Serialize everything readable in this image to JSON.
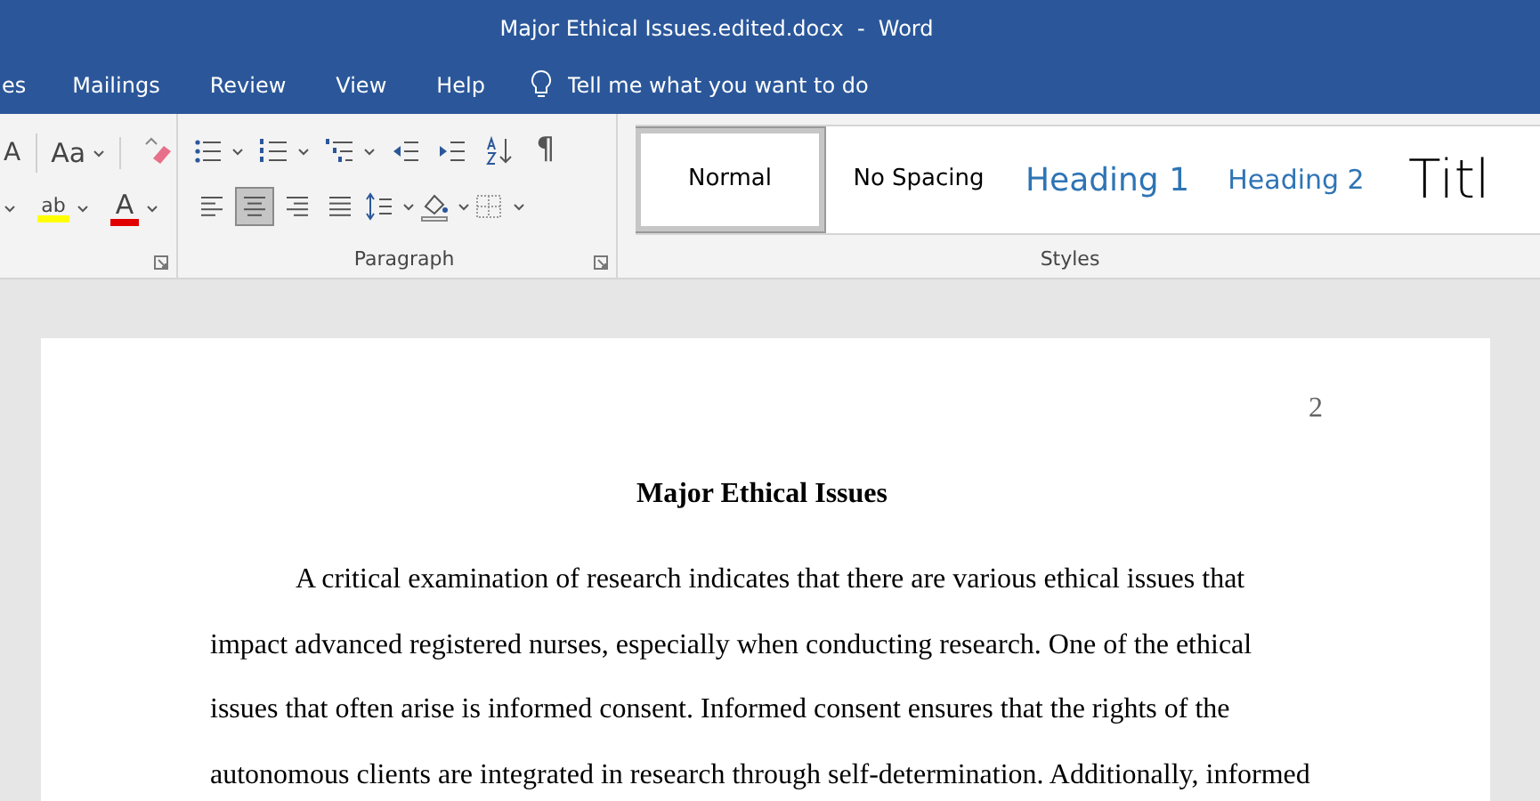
{
  "window": {
    "title": "Major Ethical Issues.edited.docx  -  Word"
  },
  "tabs": [
    {
      "label": "es",
      "selected": false
    },
    {
      "label": "Mailings",
      "selected": false
    },
    {
      "label": "Review",
      "selected": false
    },
    {
      "label": "View",
      "selected": false
    },
    {
      "label": "Help",
      "selected": false
    }
  ],
  "tell_me": {
    "placeholder": "Tell me what you want to do"
  },
  "font_group": {
    "row1": [
      {
        "kind": "shrink",
        "label": "A"
      },
      {
        "kind": "case",
        "label": "Aa"
      },
      {
        "kind": "clear"
      }
    ],
    "row2": [
      {
        "kind": "highlight",
        "label": "ab"
      },
      {
        "kind": "color",
        "label": "A"
      }
    ]
  },
  "paragraph_group": {
    "label": "Paragraph",
    "row1": [
      {
        "kind": "bullets"
      },
      {
        "kind": "numbering"
      },
      {
        "kind": "multilevel"
      },
      {
        "kind": "outdent"
      },
      {
        "kind": "indent"
      },
      {
        "kind": "sort"
      },
      {
        "kind": "pilcrow",
        "label": "¶"
      }
    ],
    "row2": [
      {
        "kind": "align-left",
        "selected": false
      },
      {
        "kind": "align-center",
        "selected": true
      },
      {
        "kind": "align-right",
        "selected": false
      },
      {
        "kind": "justify",
        "selected": false
      },
      {
        "kind": "line-spacing"
      },
      {
        "kind": "shading"
      },
      {
        "kind": "borders"
      }
    ]
  },
  "styles_group": {
    "label": "Styles",
    "styles": [
      {
        "label": "Normal",
        "kind": "normal",
        "selected": true
      },
      {
        "label": "No Spacing",
        "kind": "normal",
        "selected": false
      },
      {
        "label": "Heading 1",
        "kind": "heading1",
        "selected": false
      },
      {
        "label": "Heading 2",
        "kind": "heading2",
        "selected": false
      },
      {
        "label": "Titl",
        "kind": "title",
        "selected": false
      }
    ]
  },
  "document": {
    "page_number": "2",
    "title": "Major Ethical Issues",
    "paragraph": "A critical examination of research indicates that there are various ethical issues that impact advanced registered nurses, especially when conducting research. One of the ethical issues that often arise is informed consent. Informed consent ensures that the rights of the autonomous clients are integrated in research through self-determination. Additionally, informed"
  }
}
